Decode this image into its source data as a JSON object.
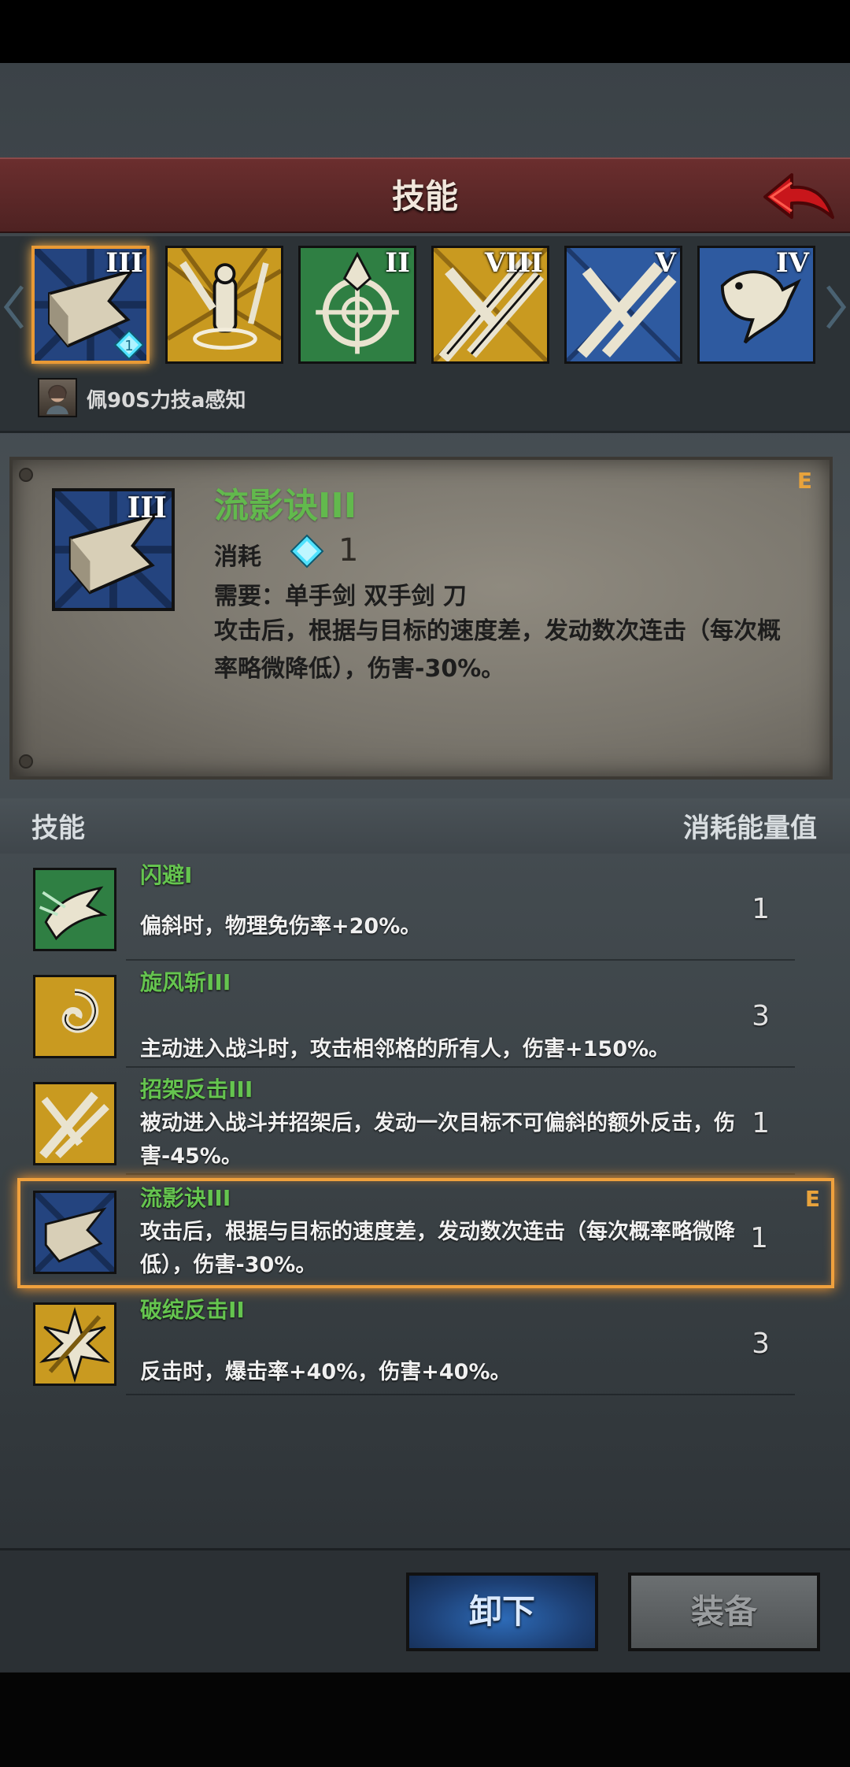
{
  "header": {
    "title": "技能"
  },
  "owner": {
    "name": "佩90S力技a感知"
  },
  "slots": [
    {
      "rank": "III",
      "theme": "blue-hook-blade",
      "selected": true,
      "gem_count": "1"
    },
    {
      "rank": "",
      "theme": "gold-monk-swords",
      "selected": false
    },
    {
      "rank": "II",
      "theme": "green-target",
      "selected": false
    },
    {
      "rank": "VIII",
      "theme": "gold-crossed-swords",
      "selected": false
    },
    {
      "rank": "V",
      "theme": "blue-crossed-swords",
      "selected": false
    },
    {
      "rank": "IV",
      "theme": "blue-beast",
      "selected": false
    }
  ],
  "detail": {
    "name": "流影诀III",
    "rank": "III",
    "grade": "E",
    "cost_label": "消耗",
    "cost_value": "1",
    "requirement": "需要：单手剑  双手剑  刀",
    "description": "攻击后，根据与目标的速度差，发动数次连击（每次概率略微降低），伤害-30%。"
  },
  "list": {
    "header_left": "技能",
    "header_right": "消耗能量值",
    "rows": [
      {
        "name": "闪避I",
        "desc": "偏斜时，物理免伤率+20%。",
        "cost": "1",
        "theme": "green-dodge"
      },
      {
        "name": "旋风斩III",
        "desc": "主动进入战斗时，攻击相邻格的所有人，伤害+150%。",
        "cost": "3",
        "theme": "gold-whirl"
      },
      {
        "name": "招架反击III",
        "desc": "被动进入战斗并招架后，发动一次目标不可偏斜的额外反击，伤害-45%。",
        "cost": "1",
        "theme": "gold-parry"
      },
      {
        "name": "流影诀III",
        "desc": "攻击后，根据与目标的速度差，发动数次连击（每次概率略微降低），伤害-30%。",
        "cost": "1",
        "grade": "E",
        "theme": "blue-hook-blade"
      },
      {
        "name": "破绽反击II",
        "desc": "反击时，爆击率+40%，伤害+40%。",
        "cost": "3",
        "theme": "gold-burst"
      }
    ]
  },
  "actions": {
    "unequip_label": "卸下",
    "equip_label": "装备"
  },
  "colors": {
    "header_red": "#5a2727",
    "skill_green": "#65c44f",
    "select_orange": "#f0a13d",
    "gem_cyan": "#4fe2ff",
    "tile_blue": "#2e5aa0",
    "tile_gold": "#c99a20",
    "tile_green": "#2f7f43"
  }
}
